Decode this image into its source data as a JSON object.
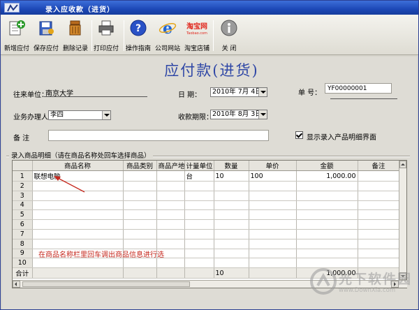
{
  "window": {
    "title": "录入应收款（进货）"
  },
  "toolbar": {
    "buttons": [
      {
        "label": "新增应付",
        "icon": "new-icon"
      },
      {
        "label": "保存应付",
        "icon": "save-icon"
      },
      {
        "label": "删除记录",
        "icon": "delete-icon"
      },
      {
        "label": "打印应付",
        "icon": "print-icon"
      },
      {
        "label": "操作指南",
        "icon": "help-icon"
      },
      {
        "label": "公司网站",
        "icon": "ie-icon"
      },
      {
        "label": "淘宝店铺",
        "icon": "taobao-icon",
        "logo_text": "淘宝网",
        "logo_sub": "Taobao.com"
      },
      {
        "label": "关  闭",
        "icon": "info-icon"
      }
    ]
  },
  "form": {
    "heading": "应付款(进货)",
    "partner_label": "往来单位：",
    "partner_value": "南京大学",
    "date_label": "日    期：",
    "date_value": "2010年 7月 4日",
    "docno_label": "单    号：",
    "docno_value": "YF00000001",
    "handler_label": "业务办理人",
    "handler_value": "李四",
    "due_label": "收款期限：",
    "due_value": "2010年 8月 3日",
    "remark_label": "备    注",
    "remark_value": "",
    "show_detail_label": "显示录入产品明细界面",
    "show_detail_checked": true
  },
  "grid": {
    "group_label": "录入商品明细（请在商品名称处回车选择商品）",
    "columns": [
      "",
      "商品名称",
      "商品类别",
      "商品产地",
      "计量单位",
      "数量",
      "单价",
      "金额",
      "备注"
    ],
    "rows": [
      [
        "1",
        "联想电脑",
        "",
        "",
        "台",
        "10",
        "100",
        "1,000.00",
        ""
      ],
      [
        "2",
        "",
        "",
        "",
        "",
        "",
        "",
        "",
        ""
      ],
      [
        "3",
        "",
        "",
        "",
        "",
        "",
        "",
        "",
        ""
      ],
      [
        "4",
        "",
        "",
        "",
        "",
        "",
        "",
        "",
        ""
      ],
      [
        "5",
        "",
        "",
        "",
        "",
        "",
        "",
        "",
        ""
      ],
      [
        "6",
        "",
        "",
        "",
        "",
        "",
        "",
        "",
        ""
      ],
      [
        "7",
        "",
        "",
        "",
        "",
        "",
        "",
        "",
        ""
      ],
      [
        "8",
        "",
        "",
        "",
        "",
        "",
        "",
        "",
        ""
      ],
      [
        "9",
        "",
        "",
        "",
        "",
        "",
        "",
        "",
        ""
      ],
      [
        "10",
        "",
        "",
        "",
        "",
        "",
        "",
        "",
        ""
      ]
    ],
    "total_label": "合计",
    "total_qty": "10",
    "total_amount": "1,000.00"
  },
  "annotation": {
    "text": "在商品名称栏里回车调出商品信息进行选",
    "color": "#c6281e"
  },
  "watermark": {
    "text": "光下软件园",
    "sub": "www.DownXia.com"
  },
  "colors": {
    "title_bar": "#1d48b7",
    "heading": "#2f47a6",
    "annotation": "#c6281e"
  }
}
